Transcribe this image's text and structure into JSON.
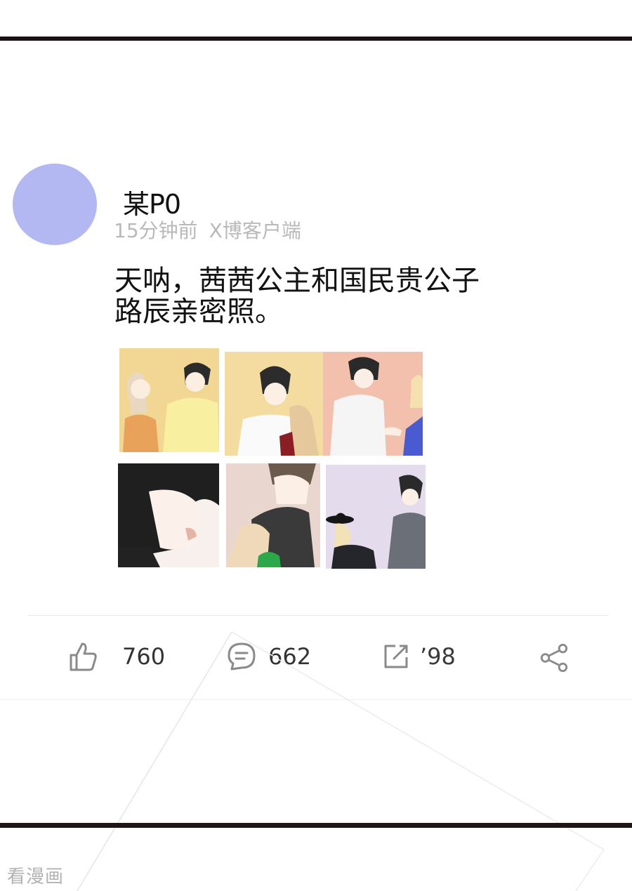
{
  "post": {
    "username": "某P0",
    "time": "15分钟前",
    "source": "X博客户端",
    "text_line1": "天呐，茜茜公主和国民贵公子",
    "text_line2": "路辰亲密照。"
  },
  "actions": {
    "like_count": "760",
    "comment_count": "662",
    "repost_count": "ʼ98"
  },
  "icons": {
    "like": "thumbs-up-icon",
    "comment": "comment-bubble-icon",
    "repost": "repost-icon",
    "share": "share-icon"
  },
  "colors": {
    "avatar": "#b3b8f2",
    "border": "#1a1212",
    "meta_text": "#b9b9b9"
  },
  "watermark": "看漫画"
}
